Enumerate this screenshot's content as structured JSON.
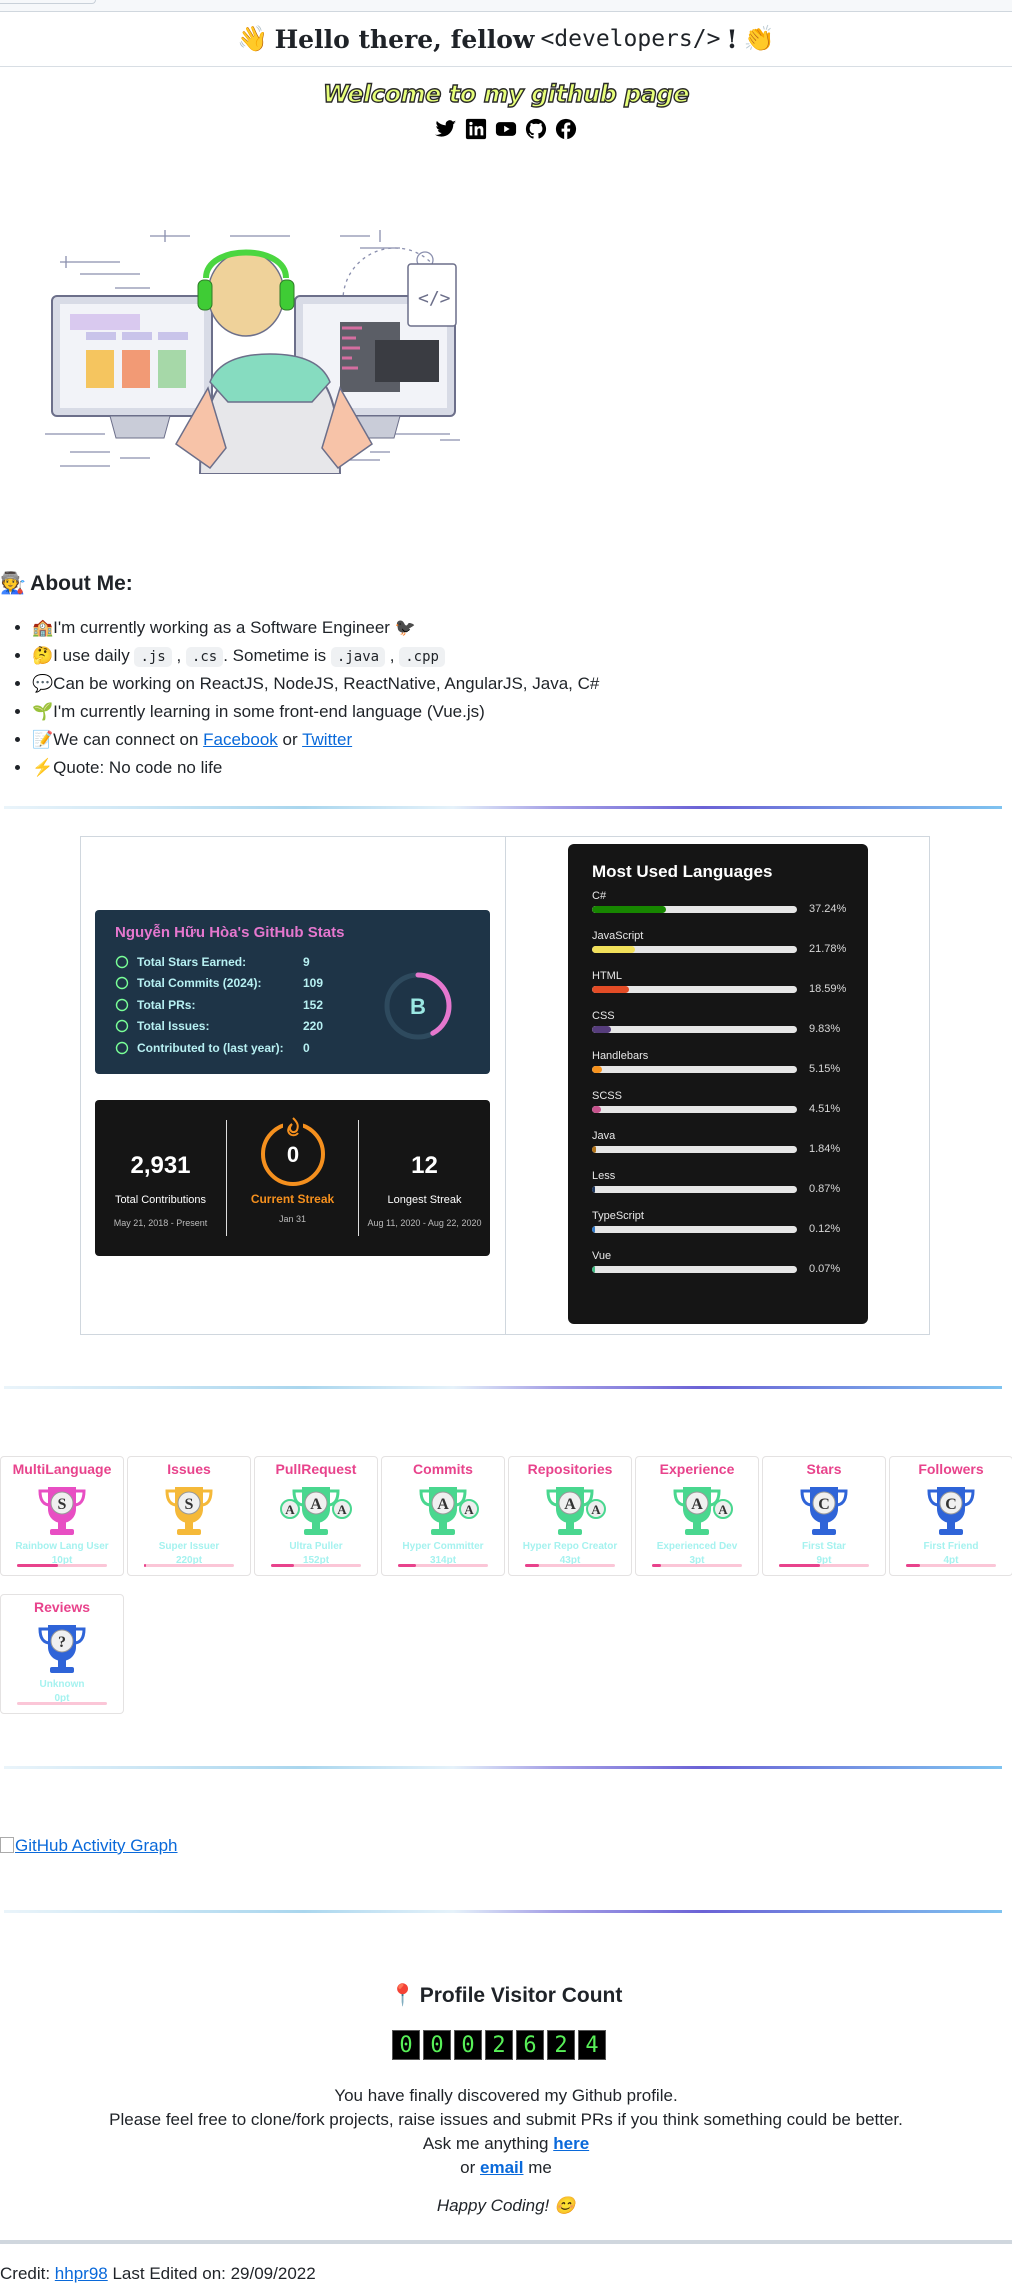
{
  "header": {
    "wave_left": "👋",
    "title_prefix": "Hello there, fellow ",
    "tag": "<developers/>",
    "title_suffix": "!",
    "wave_right": "👏"
  },
  "welcome": "Welcome to my github page",
  "socials": [
    "twitter-icon",
    "linkedin-icon",
    "youtube-icon",
    "github-icon",
    "facebook-icon"
  ],
  "about": {
    "title_icon": "🧑‍🏭",
    "title": "About Me:",
    "items": [
      {
        "icon": "🏫",
        "text": "I'm currently working as a Software Engineer"
      },
      {
        "icon": "🤔",
        "text": "I use daily ",
        "codes": [
          ".js",
          ".cs",
          ".java",
          ".cpp"
        ],
        "mid": ". Sometime is "
      },
      {
        "icon": "💬",
        "text": "Can be working on ReactJS, NodeJS, ReactNative, AngularJS, Java, C#"
      },
      {
        "icon": "🌱",
        "text": "I'm currently learning in some front-end language (Vue.js)"
      },
      {
        "icon": "📝",
        "text": "We can connect on ",
        "link1": "Facebook",
        "or": " or ",
        "link2": "Twitter"
      },
      {
        "icon": "⚡",
        "text": "Quote: No code no life"
      }
    ]
  },
  "gh_stats": {
    "title": "Nguyễn Hữu Hòa's GitHub Stats",
    "rows": [
      {
        "label": "Total Stars Earned:",
        "value": "9"
      },
      {
        "label": "Total Commits (2024):",
        "value": "109"
      },
      {
        "label": "Total PRs:",
        "value": "152"
      },
      {
        "label": "Total Issues:",
        "value": "220"
      },
      {
        "label": "Contributed to (last year):",
        "value": "0"
      }
    ],
    "grade": "B",
    "grade_progress": 0.42
  },
  "streak": {
    "total": "2,931",
    "total_label": "Total Contributions",
    "total_range": "May 21, 2018 - Present",
    "current": "0",
    "current_label": "Current Streak",
    "current_range": "Jan 31",
    "longest": "12",
    "longest_label": "Longest Streak",
    "longest_range": "Aug 11, 2020 - Aug 22, 2020"
  },
  "languages": {
    "title": "Most Used Languages",
    "items": [
      {
        "name": "C#",
        "pct": "37.24%",
        "value": 37.24,
        "color": "#178600"
      },
      {
        "name": "JavaScript",
        "pct": "21.78%",
        "value": 21.78,
        "color": "#f1e05a"
      },
      {
        "name": "HTML",
        "pct": "18.59%",
        "value": 18.59,
        "color": "#e34c26"
      },
      {
        "name": "CSS",
        "pct": "9.83%",
        "value": 9.83,
        "color": "#563d7c"
      },
      {
        "name": "Handlebars",
        "pct": "5.15%",
        "value": 5.15,
        "color": "#f7931e"
      },
      {
        "name": "SCSS",
        "pct": "4.51%",
        "value": 4.51,
        "color": "#c6538c"
      },
      {
        "name": "Java",
        "pct": "1.84%",
        "value": 1.84,
        "color": "#b07219"
      },
      {
        "name": "Less",
        "pct": "0.87%",
        "value": 0.87,
        "color": "#1d365d"
      },
      {
        "name": "TypeScript",
        "pct": "0.12%",
        "value": 0.12,
        "color": "#3178c6"
      },
      {
        "name": "Vue",
        "pct": "0.07%",
        "value": 0.07,
        "color": "#41b883"
      }
    ]
  },
  "trophies": [
    {
      "title": "MultiLanguage",
      "rank": "S",
      "name": "Rainbow Lang User",
      "pt": "10pt",
      "progress": 0.45
    },
    {
      "title": "Issues",
      "rank": "S",
      "name": "Super Issuer",
      "pt": "220pt",
      "progress": 0.02
    },
    {
      "title": "PullRequest",
      "rank": "AAA",
      "name": "Ultra Puller",
      "pt": "152pt",
      "progress": 0.25
    },
    {
      "title": "Commits",
      "rank": "AA",
      "name": "Hyper Committer",
      "pt": "314pt",
      "progress": 0.2
    },
    {
      "title": "Repositories",
      "rank": "AA",
      "name": "Hyper Repo Creator",
      "pt": "43pt",
      "progress": 0.15
    },
    {
      "title": "Experience",
      "rank": "AA",
      "name": "Experienced Dev",
      "pt": "3pt",
      "progress": 0.1
    },
    {
      "title": "Stars",
      "rank": "C",
      "name": "First Star",
      "pt": "9pt",
      "progress": 0.45
    },
    {
      "title": "Followers",
      "rank": "C",
      "name": "First Friend",
      "pt": "4pt",
      "progress": 0.15
    },
    {
      "title": "Reviews",
      "rank": "?",
      "name": "Unknown",
      "pt": "0pt",
      "progress": 0
    }
  ],
  "activity_alt": "GitHub Activity Graph",
  "visitor": {
    "icon": "📍",
    "title": "Profile Visitor Count",
    "digits": [
      "0",
      "0",
      "0",
      "2",
      "6",
      "2",
      "4"
    ]
  },
  "closing": {
    "line1": "You have finally discovered my Github profile.",
    "line2": "Please feel free to clone/fork projects, raise issues and submit PRs if you think something could be better.",
    "line3_pre": "Ask me anything ",
    "line3_link": "here",
    "line4_pre": "or ",
    "line4_link": "email",
    "line4_post": " me",
    "happy": "Happy Coding! 😊"
  },
  "credit": {
    "pre": "Credit: ",
    "link": "hhpr98",
    "post": " Last Edited on: 29/09/2022"
  }
}
